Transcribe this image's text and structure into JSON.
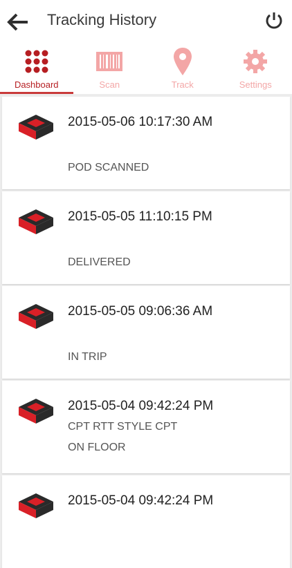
{
  "header": {
    "title": "Tracking History"
  },
  "tabs": [
    {
      "label": "Dashboard",
      "icon": "grid-dots-icon",
      "active": true
    },
    {
      "label": "Scan",
      "icon": "barcode-icon",
      "active": false
    },
    {
      "label": "Track",
      "icon": "location-pin-icon",
      "active": false
    },
    {
      "label": "Settings",
      "icon": "gear-icon",
      "active": false
    }
  ],
  "colors": {
    "accent": "#b61e22",
    "inactive_tab": "#f3a6a6"
  },
  "entries": [
    {
      "datetime": "2015-05-06 10:17:30 AM",
      "status": "POD SCANNED"
    },
    {
      "datetime": "2015-05-05 11:10:15 PM",
      "status": "DELIVERED"
    },
    {
      "datetime": "2015-05-05 09:06:36 AM",
      "status": "IN TRIP"
    },
    {
      "datetime": "2015-05-04 09:42:24 PM",
      "status_line1": "CPT RTT STYLE CPT",
      "status_line2": "ON FLOOR"
    },
    {
      "datetime": "2015-05-04 09:42:24 PM",
      "status": ""
    }
  ]
}
